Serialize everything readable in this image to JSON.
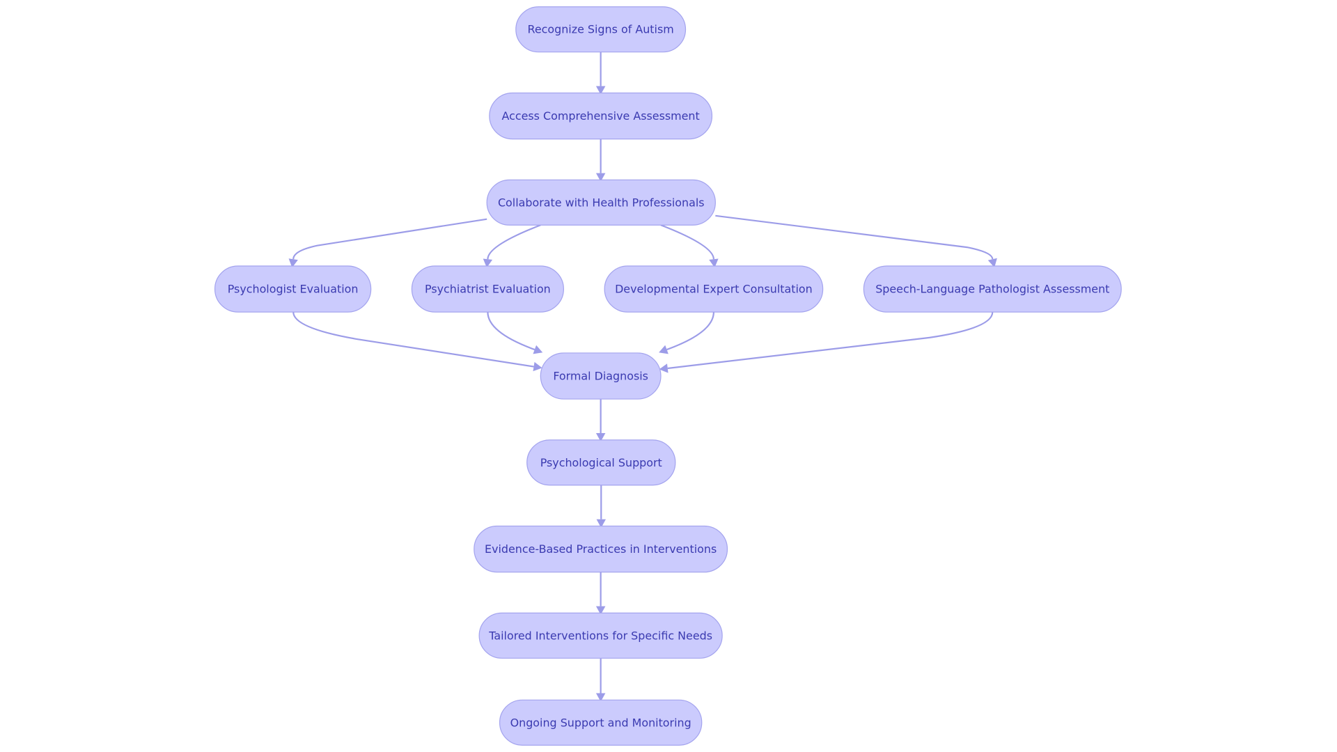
{
  "diagram": {
    "type": "flowchart",
    "direction": "top-down",
    "colors": {
      "node_fill": "#cbcbfd",
      "node_stroke": "#a4a4ee",
      "text": "#3a3ab0",
      "edge": "#9c9ce8"
    },
    "nodes": [
      {
        "id": "A",
        "label": "Recognize Signs of Autism"
      },
      {
        "id": "B",
        "label": "Access Comprehensive Assessment"
      },
      {
        "id": "C",
        "label": "Collaborate with Health Professionals"
      },
      {
        "id": "D",
        "label": "Psychologist Evaluation"
      },
      {
        "id": "E",
        "label": "Psychiatrist Evaluation"
      },
      {
        "id": "F",
        "label": "Developmental Expert Consultation"
      },
      {
        "id": "G",
        "label": "Speech-Language Pathologist Assessment"
      },
      {
        "id": "H",
        "label": "Formal Diagnosis"
      },
      {
        "id": "I",
        "label": "Psychological Support"
      },
      {
        "id": "J",
        "label": "Evidence-Based Practices in Interventions"
      },
      {
        "id": "K",
        "label": "Tailored Interventions for Specific Needs"
      },
      {
        "id": "L",
        "label": "Ongoing Support and Monitoring"
      }
    ],
    "edges": [
      {
        "from": "A",
        "to": "B"
      },
      {
        "from": "B",
        "to": "C"
      },
      {
        "from": "C",
        "to": "D"
      },
      {
        "from": "C",
        "to": "E"
      },
      {
        "from": "C",
        "to": "F"
      },
      {
        "from": "C",
        "to": "G"
      },
      {
        "from": "D",
        "to": "H"
      },
      {
        "from": "E",
        "to": "H"
      },
      {
        "from": "F",
        "to": "H"
      },
      {
        "from": "G",
        "to": "H"
      },
      {
        "from": "H",
        "to": "I"
      },
      {
        "from": "I",
        "to": "J"
      },
      {
        "from": "J",
        "to": "K"
      },
      {
        "from": "K",
        "to": "L"
      }
    ]
  }
}
